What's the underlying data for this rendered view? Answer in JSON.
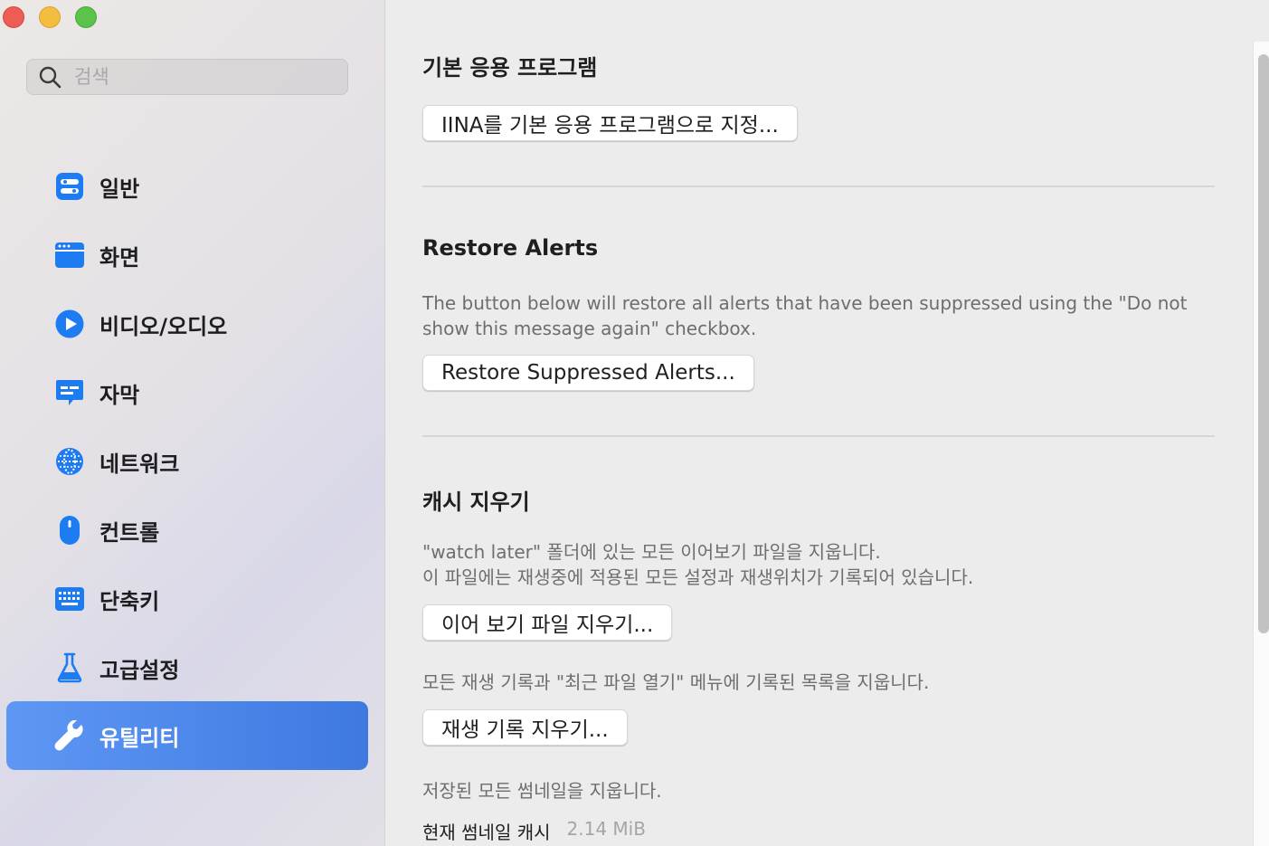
{
  "window": {
    "controls": [
      "close",
      "minimize",
      "zoom"
    ]
  },
  "search": {
    "placeholder": "검색",
    "icon": "search-icon"
  },
  "sidebar": {
    "items": [
      {
        "label": "일반",
        "icon": "general-toggle-icon",
        "active": false
      },
      {
        "label": "화면",
        "icon": "window-icon",
        "active": false
      },
      {
        "label": "비디오/오디오",
        "icon": "play-icon",
        "active": false
      },
      {
        "label": "자막",
        "icon": "subtitle-icon",
        "active": false
      },
      {
        "label": "네트워크",
        "icon": "globe-icon",
        "active": false
      },
      {
        "label": "컨트롤",
        "icon": "mouse-icon",
        "active": false
      },
      {
        "label": "단축키",
        "icon": "keyboard-icon",
        "active": false
      },
      {
        "label": "고급설정",
        "icon": "flask-icon",
        "active": false
      },
      {
        "label": "유틸리티",
        "icon": "wrench-icon",
        "active": true
      }
    ],
    "accent_color": "#4a86ec",
    "icon_color": "#1e7cf2"
  },
  "main": {
    "default_app": {
      "title": "기본 응용 프로그램",
      "button": "IINA를 기본 응용 프로그램으로 지정..."
    },
    "restore_alerts": {
      "title": "Restore Alerts",
      "description": "The button below will restore all alerts that have been suppressed using the \"Do not show this message again\" checkbox.",
      "button": "Restore Suppressed Alerts..."
    },
    "clear_cache": {
      "title": "캐시 지우기",
      "watch_later_desc_1": "\"watch later\" 폴더에 있는 모든 이어보기 파일을 지웁니다.",
      "watch_later_desc_2": "이 파일에는 재생중에 적용된 모든 설정과 재생위치가 기록되어 있습니다.",
      "watch_later_button": "이어 보기 파일 지우기...",
      "history_desc": "모든 재생 기록과 \"최근 파일 열기\" 메뉴에 기록된 목록을 지웁니다.",
      "history_button": "재생 기록 지우기...",
      "thumbnail_desc": "저장된 모든 썸네일을 지웁니다.",
      "thumbnail_cache_label": "현재 썸네일 캐시",
      "thumbnail_cache_value": "2.14 MiB"
    }
  }
}
